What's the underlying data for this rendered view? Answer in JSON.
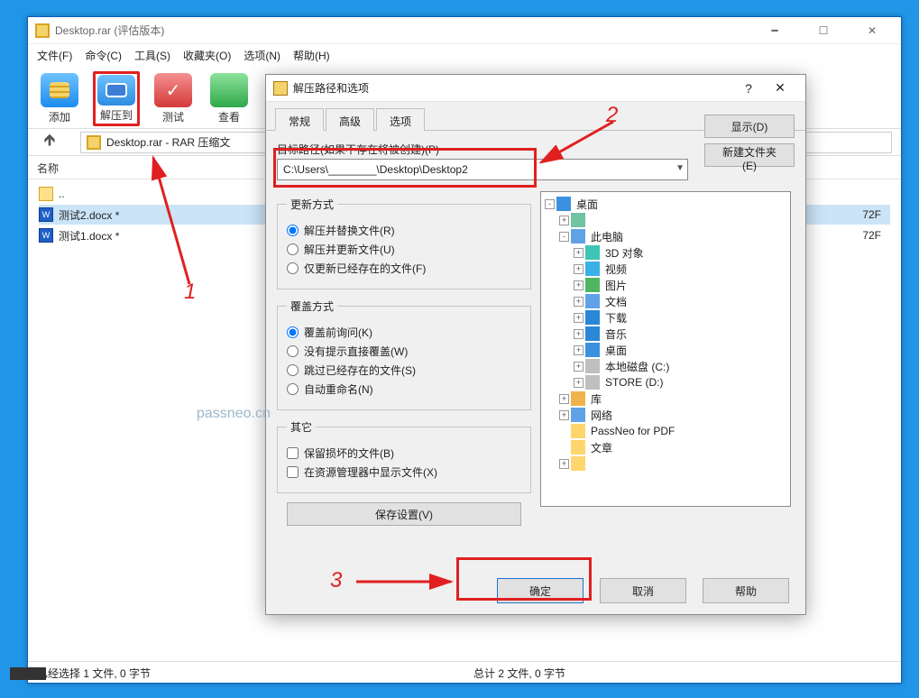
{
  "main_window": {
    "title": "Desktop.rar (评估版本)",
    "menu": [
      "文件(F)",
      "命令(C)",
      "工具(S)",
      "收藏夹(O)",
      "选项(N)",
      "帮助(H)"
    ],
    "toolbar": {
      "add": "添加",
      "extract": "解压到",
      "test": "测试",
      "view": "查看"
    },
    "path": "Desktop.rar - RAR 压缩文",
    "cols": {
      "name": "名称",
      "size_sample": "72F"
    },
    "files": [
      {
        "name": "..",
        "kind": "up"
      },
      {
        "name": "测试2.docx *",
        "kind": "doc",
        "size": "72F"
      },
      {
        "name": "测试1.docx *",
        "kind": "doc",
        "size": "72F"
      }
    ],
    "status_left": "已经选择 1 文件, 0 字节",
    "status_right": "总计 2 文件, 0 字节"
  },
  "dialog": {
    "title": "解压路径和选项",
    "tabs": [
      "常规",
      "高级",
      "选项"
    ],
    "path_label": "目标路径(如果不存在将被创建)(P)",
    "path_value": "C:\\Users\\________\\Desktop\\Desktop2",
    "show_btn": "显示(D)",
    "newfolder_btn": "新建文件夹(E)",
    "update_legend": "更新方式",
    "update_opts": [
      "解压并替换文件(R)",
      "解压并更新文件(U)",
      "仅更新已经存在的文件(F)"
    ],
    "overwrite_legend": "覆盖方式",
    "overwrite_opts": [
      "覆盖前询问(K)",
      "没有提示直接覆盖(W)",
      "跳过已经存在的文件(S)",
      "自动重命名(N)"
    ],
    "misc_legend": "其它",
    "misc_opts": [
      "保留损坏的文件(B)",
      "在资源管理器中显示文件(X)"
    ],
    "save_settings": "保存设置(V)",
    "tree": [
      {
        "l": 0,
        "e": "-",
        "i": "i-desk",
        "t": "桌面"
      },
      {
        "l": 1,
        "e": "+",
        "i": "i-user",
        "t": ""
      },
      {
        "l": 1,
        "e": "-",
        "i": "i-pc",
        "t": "此电脑"
      },
      {
        "l": 2,
        "e": "+",
        "i": "i-3d",
        "t": "3D 对象"
      },
      {
        "l": 2,
        "e": "+",
        "i": "i-vid",
        "t": "视频"
      },
      {
        "l": 2,
        "e": "+",
        "i": "i-pic",
        "t": "图片"
      },
      {
        "l": 2,
        "e": "+",
        "i": "i-doc",
        "t": "文档"
      },
      {
        "l": 2,
        "e": "+",
        "i": "i-dl",
        "t": "下载"
      },
      {
        "l": 2,
        "e": "+",
        "i": "i-mus",
        "t": "音乐"
      },
      {
        "l": 2,
        "e": "+",
        "i": "i-desk",
        "t": "桌面"
      },
      {
        "l": 2,
        "e": "+",
        "i": "i-hdd",
        "t": "本地磁盘 (C:)"
      },
      {
        "l": 2,
        "e": "+",
        "i": "i-hdd",
        "t": "STORE (D:)"
      },
      {
        "l": 1,
        "e": "+",
        "i": "i-lib",
        "t": "库"
      },
      {
        "l": 1,
        "e": "+",
        "i": "i-net",
        "t": "网络"
      },
      {
        "l": 1,
        "e": "",
        "i": "i-fld",
        "t": "PassNeo for PDF"
      },
      {
        "l": 1,
        "e": "",
        "i": "i-fld",
        "t": "文章"
      },
      {
        "l": 1,
        "e": "+",
        "i": "i-fld",
        "t": ""
      }
    ],
    "ok": "确定",
    "cancel": "取消",
    "help": "帮助"
  },
  "annotations": {
    "l1": "1",
    "l2": "2",
    "l3": "3",
    "watermark": "passneo.cn"
  }
}
